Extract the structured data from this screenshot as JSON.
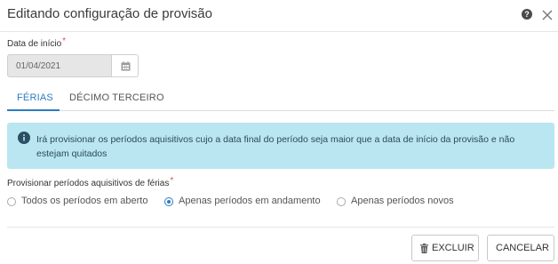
{
  "dialog": {
    "title": "Editando configuração de provisão"
  },
  "form": {
    "start_date_label": "Data de início",
    "start_date_required": "*",
    "start_date_value": "01/04/2021"
  },
  "tabs": [
    {
      "label": "FÉRIAS",
      "active": true
    },
    {
      "label": "DÉCIMO TERCEIRO",
      "active": false
    }
  ],
  "alert": {
    "text": "Irá provisionar os períodos aquisitivos cujo a data final do período seja maior que a data de início da provisão e não estejam quitados"
  },
  "provision": {
    "label": "Provisionar períodos aquisitivos de férias",
    "required": "*",
    "options": [
      {
        "label": "Todos os períodos em aberto",
        "selected": false
      },
      {
        "label": "Apenas períodos em andamento",
        "selected": true
      },
      {
        "label": "Apenas períodos novos",
        "selected": false
      }
    ]
  },
  "footer": {
    "delete_label": "EXCLUIR",
    "cancel_label": "CANCELAR"
  },
  "colors": {
    "accent": "#2d7cc1",
    "alert_bg": "#b9e6f0",
    "required": "#d9534f"
  }
}
